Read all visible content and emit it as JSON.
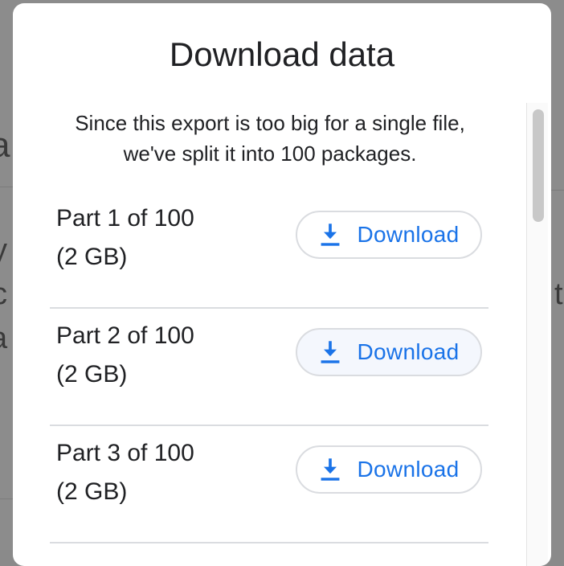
{
  "dialog": {
    "title": "Download data",
    "intro_line1": "Since this export is too big for a single file,",
    "intro_line2": "we've split it into 100 packages."
  },
  "parts": [
    {
      "title": "Part 1 of 100",
      "size": "(2 GB)",
      "button_label": "Download"
    },
    {
      "title": "Part 2 of 100",
      "size": "(2 GB)",
      "button_label": "Download"
    },
    {
      "title": "Part 3 of 100",
      "size": "(2 GB)",
      "button_label": "Download"
    }
  ],
  "colors": {
    "accent": "#1a73e8",
    "divider": "#dadce0",
    "text": "#202124",
    "backdrop": "#8c8c8c"
  },
  "icons": {
    "download": "download-icon"
  }
}
